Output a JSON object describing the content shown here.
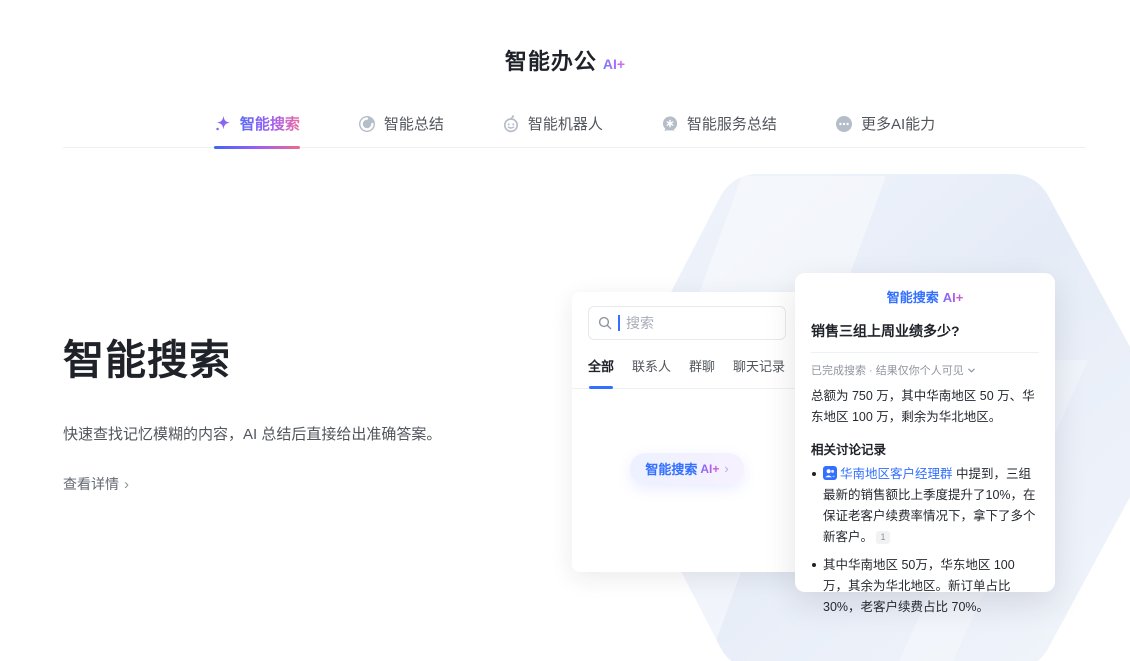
{
  "page": {
    "title": "智能办公",
    "title_badge": "AI+"
  },
  "tabs": [
    {
      "label": "智能搜索",
      "icon": "sparkle-icon",
      "active": true
    },
    {
      "label": "智能总结",
      "icon": "summary-swirl-icon",
      "active": false
    },
    {
      "label": "智能机器人",
      "icon": "robot-icon",
      "active": false
    },
    {
      "label": "智能服务总结",
      "icon": "service-chat-icon",
      "active": false
    },
    {
      "label": "更多AI能力",
      "icon": "more-dots-icon",
      "active": false
    }
  ],
  "hero": {
    "heading": "智能搜索",
    "description": "快速查找记忆模糊的内容，AI 总结后直接给出准确答案。",
    "link_label": "查看详情"
  },
  "search_card": {
    "input_placeholder": "搜索",
    "tabs": [
      {
        "label": "全部",
        "active": true
      },
      {
        "label": "联系人",
        "active": false
      },
      {
        "label": "群聊",
        "active": false
      },
      {
        "label": "聊天记录",
        "active": false
      }
    ],
    "pill": {
      "text": "智能搜索",
      "badge": "AI+",
      "chevron": "›"
    }
  },
  "ai_panel": {
    "header_text": "智能搜索",
    "header_badge": "AI+",
    "question": "销售三组上周业绩多少?",
    "status": "已完成搜索 · 结果仅你个人可见",
    "answer": "总额为 750 万，其中华南地区 50 万、华东地区 100 万，剩余为华北地区。",
    "section_title": "相关讨论记录",
    "bullets": [
      {
        "link": "华南地区客户经理群",
        "text": " 中提到，三组最新的销售额比上季度提升了10%，在保证老客户续费率情况下，拿下了多个新客户。",
        "footnote": "1"
      },
      {
        "text": "其中华南地区 50万，华东地区 100 万，其余为华北地区。新订单占比 30%，老客户续费占比 70%。"
      }
    ]
  },
  "icons": {
    "link_chevron": "›",
    "pill_chevron": "›"
  },
  "colors": {
    "accent_blue": "#3370ff",
    "gradient_blue": "#5a6bf5",
    "gradient_purple": "#9a5ef7",
    "gradient_pink": "#ef6a9e",
    "bg_hexagon": "#e7ecf8",
    "text_primary": "#1f2329",
    "text_secondary": "#51565d",
    "text_muted": "#8f959e"
  }
}
